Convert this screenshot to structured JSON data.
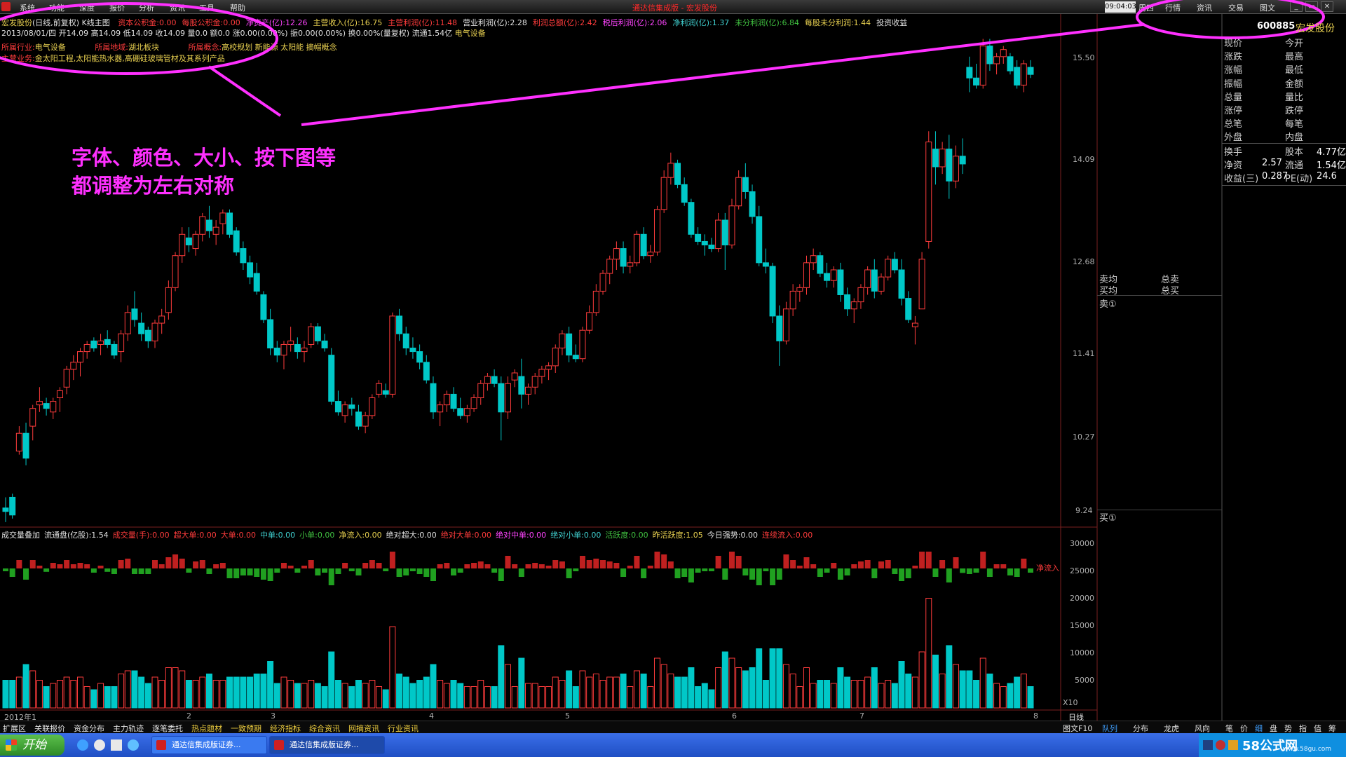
{
  "menu": {
    "items": [
      "系统",
      "功能",
      "深度",
      "报价",
      "分析",
      "资讯",
      "工具",
      "帮助"
    ],
    "app_title": "通达信集成版 - 宏发股份",
    "clock": "09:04:03",
    "weekday": "周四",
    "nav": [
      "行情",
      "资讯",
      "交易",
      "图文"
    ]
  },
  "header": {
    "stock_name": "宏发股份",
    "chart_mode": "(日线,前复权)",
    "chart_kind": "K线主图",
    "fund_items": [
      {
        "label": "资本公积金",
        "value": "0.00"
      },
      {
        "label": "每股公积金",
        "value": "0.00"
      },
      {
        "label": "净资产(亿)",
        "value": "12.26"
      },
      {
        "label": "主营收入(亿)",
        "value": "16.75"
      },
      {
        "label": "主营利润(亿)",
        "value": "11.48"
      },
      {
        "label": "营业利润(亿)",
        "value": "2.28"
      },
      {
        "label": "利润总额(亿)",
        "value": "2.42"
      },
      {
        "label": "税后利润(亿)",
        "value": "2.06"
      },
      {
        "label": "净利润(亿)",
        "value": "1.37"
      },
      {
        "label": "未分利润(亿)",
        "value": "6.84"
      },
      {
        "label": "每股未分利润",
        "value": "1.44"
      },
      {
        "label": "投资收益",
        "value": ""
      }
    ],
    "day_info": "2013/08/01/四 开14.09 高14.09 低14.09 收14.09 量0.0 额0.0 涨0.00(0.00%) 振0.00(0.00%) 换0.00%(量复权) 流通1.54亿",
    "sector": "电气设备",
    "industry_label": "所属行业:",
    "industry_value": "电气设备",
    "region_label": "所属地域:",
    "region_value": "湖北板块",
    "concept_label": "所属概念:",
    "concept_value": "高校规划 新能源 太阳能 摘帽概念",
    "business_label": "主营业务:",
    "business_value": "金太阳工程,太阳能热水器,高硼硅玻璃管材及其系列产品"
  },
  "annotation": {
    "line1": "字体、颜色、大小、按下图等",
    "line2": "都调整为左右对称"
  },
  "price_axis": [
    "15.50",
    "14.09",
    "12.68",
    "11.41",
    "10.27",
    "9.24"
  ],
  "vol_header": [
    {
      "text": "成交量叠加",
      "color": "white"
    },
    {
      "text": "流通盘(亿股):1.54",
      "color": "white"
    },
    {
      "text": "成交量(手):0.00",
      "color": "red"
    },
    {
      "text": "超大单:0.00",
      "color": "red"
    },
    {
      "text": "大单:0.00",
      "color": "red"
    },
    {
      "text": "中单:0.00",
      "color": "cyan"
    },
    {
      "text": "小单:0.00",
      "color": "green"
    },
    {
      "text": "净流入:0.00",
      "color": "yellow"
    },
    {
      "text": "绝对超大:0.00",
      "color": "white"
    },
    {
      "text": "绝对大单:0.00",
      "color": "red"
    },
    {
      "text": "绝对中单:0.00",
      "color": "magenta"
    },
    {
      "text": "绝对小单:0.00",
      "color": "cyan"
    },
    {
      "text": "活跃度:0.00",
      "color": "green"
    },
    {
      "text": "昨活跃度:1.05",
      "color": "yellow"
    },
    {
      "text": "今日强势:0.00",
      "color": "white"
    },
    {
      "text": "连续流入:0.00",
      "color": "red"
    }
  ],
  "vol_axis": [
    "30000",
    "25000",
    "20000",
    "15000",
    "10000",
    "5000"
  ],
  "net_inflow_label": "净流入",
  "x10": "X10",
  "date_axis": {
    "first": "2012年1",
    "ticks": [
      "2",
      "3",
      "4",
      "5",
      "6",
      "7",
      "8"
    ],
    "period": "日线"
  },
  "right_panel": {
    "code": "600885",
    "name": "宏发股份",
    "rows": [
      {
        "l": "现价",
        "r": "今开"
      },
      {
        "l": "涨跌",
        "r": "最高"
      },
      {
        "l": "涨幅",
        "r": "最低"
      },
      {
        "l": "振幅",
        "r": "金额"
      },
      {
        "l": "总量",
        "r": "量比"
      },
      {
        "l": "涨停",
        "r": "跌停"
      },
      {
        "l": "总笔",
        "r": "每笔"
      },
      {
        "l": "外盘",
        "r": "内盘"
      }
    ],
    "fin_rows": [
      {
        "l": "换手",
        "lv": "",
        "r": "股本",
        "rv": "4.77亿"
      },
      {
        "l": "净资",
        "lv": "2.57",
        "r": "流通",
        "rv": "1.54亿"
      },
      {
        "l": "收益(三)",
        "lv": "0.287",
        "r": "PE(动)",
        "rv": "24.6"
      }
    ]
  },
  "mid_panel": {
    "sell_avg": "卖均",
    "total_sell": "总卖",
    "buy_avg": "买均",
    "total_buy": "总买",
    "sell1": "卖①",
    "buy1": "买①"
  },
  "bottom_tabs": [
    "扩展区",
    "关联报价",
    "资金分布",
    "主力轨迹",
    "逐笔委托",
    "热点题材",
    "一致预期",
    "经济指标",
    "综合资讯",
    "网摘资讯",
    "行业资讯"
  ],
  "bottom_tabs_yellow": [
    5,
    6,
    7,
    8,
    9,
    10
  ],
  "bottom_right": {
    "f10": "图文F10",
    "tabs": [
      "队列",
      "分布",
      "龙虎",
      "风向"
    ],
    "small": [
      "笔",
      "价",
      "细",
      "盘",
      "势",
      "指",
      "值",
      "筹"
    ]
  },
  "taskbar": {
    "start": "开始",
    "tasks": [
      "通达信集成版证券...",
      "通达信集成版证券..."
    ],
    "watermark": "58公式网",
    "watermark_url": "www.58gu.com"
  },
  "chart_data": {
    "type": "candlestick",
    "y_axis_ticks": [
      15.5,
      14.09,
      12.68,
      11.41,
      10.27,
      9.24
    ],
    "ylim": [
      9.0,
      16.2
    ],
    "x_month_labels": [
      "2012年1",
      "2",
      "3",
      "4",
      "5",
      "6",
      "7",
      "8"
    ],
    "series": [
      {
        "name": "K线",
        "values": [
          [
            9.25,
            9.4,
            9.05,
            9.2
          ],
          [
            9.4,
            9.45,
            9.1,
            9.15
          ],
          [
            10.05,
            10.4,
            10.0,
            10.3
          ],
          [
            10.3,
            10.45,
            9.85,
            9.95
          ],
          [
            10.4,
            10.7,
            10.2,
            10.65
          ],
          [
            10.7,
            10.95,
            10.6,
            10.75
          ],
          [
            10.72,
            10.8,
            10.55,
            10.65
          ],
          [
            10.6,
            10.8,
            10.5,
            10.75
          ],
          [
            10.8,
            10.95,
            10.6,
            10.9
          ],
          [
            10.95,
            11.25,
            10.85,
            11.2
          ],
          [
            11.2,
            11.4,
            11.05,
            11.3
          ],
          [
            11.3,
            11.5,
            11.1,
            11.45
          ],
          [
            11.45,
            11.6,
            11.35,
            11.55
          ],
          [
            11.6,
            11.65,
            11.45,
            11.5
          ],
          [
            11.55,
            11.7,
            11.4,
            11.6
          ],
          [
            11.62,
            11.75,
            11.5,
            11.55
          ],
          [
            11.55,
            11.6,
            11.35,
            11.4
          ],
          [
            11.45,
            11.75,
            11.3,
            11.7
          ],
          [
            11.7,
            12.1,
            11.6,
            12.0
          ],
          [
            12.05,
            12.3,
            11.8,
            11.9
          ],
          [
            11.85,
            12.0,
            11.6,
            11.7
          ],
          [
            11.75,
            11.8,
            11.5,
            11.6
          ],
          [
            11.6,
            11.9,
            11.5,
            11.85
          ],
          [
            11.85,
            12.05,
            11.7,
            11.95
          ],
          [
            12.0,
            12.45,
            11.9,
            12.35
          ],
          [
            12.35,
            12.85,
            12.3,
            12.8
          ],
          [
            12.8,
            13.2,
            12.7,
            13.1
          ],
          [
            13.05,
            13.2,
            12.85,
            12.95
          ],
          [
            12.9,
            13.15,
            12.8,
            13.1
          ],
          [
            13.1,
            13.4,
            13.0,
            13.35
          ],
          [
            13.3,
            13.5,
            13.05,
            13.15
          ],
          [
            13.1,
            13.3,
            12.95,
            13.2
          ],
          [
            13.25,
            13.45,
            13.1,
            13.4
          ],
          [
            13.4,
            13.45,
            13.05,
            13.1
          ],
          [
            13.15,
            13.2,
            12.8,
            12.85
          ],
          [
            12.9,
            13.0,
            12.6,
            12.7
          ],
          [
            12.7,
            12.8,
            12.4,
            12.5
          ],
          [
            12.55,
            12.7,
            12.25,
            12.3
          ],
          [
            12.25,
            12.3,
            11.85,
            11.9
          ],
          [
            11.9,
            12.05,
            11.4,
            11.5
          ],
          [
            11.5,
            11.6,
            11.3,
            11.4
          ],
          [
            11.4,
            11.6,
            11.2,
            11.55
          ],
          [
            11.55,
            11.8,
            11.45,
            11.6
          ],
          [
            11.55,
            11.65,
            11.35,
            11.45
          ],
          [
            11.45,
            11.6,
            11.3,
            11.5
          ],
          [
            11.55,
            11.85,
            11.5,
            11.8
          ],
          [
            11.8,
            11.85,
            11.55,
            11.6
          ],
          [
            11.6,
            11.7,
            11.45,
            11.5
          ],
          [
            11.4,
            11.5,
            10.7,
            10.75
          ],
          [
            10.75,
            10.9,
            10.55,
            10.6
          ],
          [
            10.55,
            10.75,
            10.45,
            10.7
          ],
          [
            10.7,
            10.8,
            10.55,
            10.65
          ],
          [
            10.6,
            10.7,
            10.35,
            10.4
          ],
          [
            10.4,
            10.6,
            10.3,
            10.55
          ],
          [
            10.55,
            10.85,
            10.5,
            10.8
          ],
          [
            10.85,
            11.05,
            10.8,
            11.0
          ],
          [
            10.9,
            11.0,
            10.8,
            10.85
          ],
          [
            10.85,
            12.0,
            10.8,
            11.95
          ],
          [
            11.95,
            12.05,
            11.6,
            11.7
          ],
          [
            11.7,
            11.8,
            11.4,
            11.5
          ],
          [
            11.5,
            11.65,
            11.35,
            11.45
          ],
          [
            11.45,
            11.55,
            11.2,
            11.3
          ],
          [
            11.3,
            11.4,
            11.0,
            11.05
          ],
          [
            11.0,
            11.1,
            10.5,
            10.6
          ],
          [
            10.6,
            10.75,
            10.4,
            10.7
          ],
          [
            10.7,
            10.9,
            10.6,
            10.85
          ],
          [
            10.85,
            10.95,
            10.6,
            10.65
          ],
          [
            10.65,
            10.8,
            10.5,
            10.55
          ],
          [
            10.55,
            10.7,
            10.45,
            10.65
          ],
          [
            10.65,
            10.85,
            10.6,
            10.8
          ],
          [
            10.8,
            11.05,
            10.7,
            11.0
          ],
          [
            11.0,
            11.15,
            10.9,
            11.1
          ],
          [
            11.1,
            11.2,
            10.95,
            11.0
          ],
          [
            11.0,
            11.1,
            10.2,
            10.6
          ],
          [
            10.6,
            11.1,
            10.5,
            11.0
          ],
          [
            11.05,
            11.2,
            10.95,
            11.15
          ],
          [
            11.1,
            11.35,
            10.65,
            10.85
          ],
          [
            10.85,
            11.0,
            10.7,
            10.95
          ],
          [
            10.95,
            11.15,
            10.85,
            11.1
          ],
          [
            11.1,
            11.25,
            11.0,
            11.2
          ],
          [
            11.2,
            11.3,
            11.05,
            11.25
          ],
          [
            11.25,
            11.55,
            11.15,
            11.5
          ],
          [
            11.5,
            11.75,
            11.4,
            11.7
          ],
          [
            11.7,
            11.8,
            11.3,
            11.4
          ],
          [
            11.4,
            11.55,
            11.3,
            11.35
          ],
          [
            11.35,
            11.8,
            11.3,
            11.75
          ],
          [
            11.75,
            12.1,
            11.7,
            12.0
          ],
          [
            12.0,
            12.4,
            11.95,
            12.3
          ],
          [
            12.3,
            12.6,
            12.25,
            12.55
          ],
          [
            12.55,
            12.8,
            12.4,
            12.75
          ],
          [
            12.75,
            13.0,
            12.6,
            12.9
          ],
          [
            12.9,
            13.0,
            12.55,
            12.65
          ],
          [
            12.65,
            12.8,
            12.55,
            12.7
          ],
          [
            12.7,
            13.15,
            12.65,
            13.1
          ],
          [
            13.1,
            13.2,
            12.75,
            12.8
          ],
          [
            12.8,
            12.95,
            12.7,
            12.85
          ],
          [
            12.85,
            13.5,
            12.8,
            13.45
          ],
          [
            13.45,
            14.0,
            13.4,
            13.9
          ],
          [
            13.9,
            14.25,
            13.8,
            14.1
          ],
          [
            14.1,
            14.15,
            13.75,
            13.8
          ],
          [
            13.8,
            13.9,
            13.5,
            13.55
          ],
          [
            13.55,
            13.6,
            13.05,
            13.1
          ],
          [
            13.1,
            13.2,
            12.95,
            13.0
          ],
          [
            13.0,
            13.1,
            12.8,
            12.95
          ],
          [
            12.95,
            13.05,
            12.85,
            12.9
          ],
          [
            12.9,
            13.4,
            12.85,
            13.3
          ],
          [
            13.3,
            13.4,
            12.6,
            12.95
          ],
          [
            12.95,
            13.6,
            12.9,
            13.5
          ],
          [
            13.5,
            14.0,
            13.45,
            13.9
          ],
          [
            13.9,
            14.1,
            13.6,
            13.7
          ],
          [
            13.7,
            13.8,
            13.25,
            13.35
          ],
          [
            13.35,
            13.5,
            12.65,
            12.7
          ],
          [
            12.7,
            12.9,
            12.55,
            12.65
          ],
          [
            12.65,
            12.7,
            11.85,
            11.95
          ],
          [
            11.95,
            12.1,
            11.25,
            11.6
          ],
          [
            11.6,
            12.15,
            11.55,
            12.05
          ],
          [
            12.05,
            12.4,
            11.95,
            12.3
          ],
          [
            12.3,
            12.4,
            12.15,
            12.35
          ],
          [
            12.35,
            12.8,
            12.25,
            12.7
          ],
          [
            12.7,
            12.9,
            12.6,
            12.8
          ],
          [
            12.8,
            12.85,
            12.5,
            12.55
          ],
          [
            12.55,
            12.7,
            12.35,
            12.45
          ],
          [
            12.45,
            12.65,
            12.35,
            12.6
          ],
          [
            12.6,
            12.7,
            12.15,
            12.25
          ],
          [
            12.25,
            12.35,
            11.95,
            12.05
          ],
          [
            12.05,
            12.2,
            11.85,
            12.15
          ],
          [
            12.15,
            12.4,
            12.05,
            12.35
          ],
          [
            12.35,
            12.65,
            12.25,
            12.6
          ],
          [
            12.6,
            12.75,
            12.2,
            12.3
          ],
          [
            12.3,
            12.55,
            12.25,
            12.5
          ],
          [
            12.5,
            12.8,
            12.45,
            12.75
          ],
          [
            12.75,
            12.85,
            12.55,
            12.6
          ],
          [
            12.6,
            12.75,
            12.1,
            12.2
          ],
          [
            12.2,
            12.3,
            11.85,
            11.9
          ],
          [
            11.8,
            11.95,
            11.55,
            11.85
          ],
          [
            12.05,
            12.85,
            12.05,
            12.75
          ],
          [
            13.0,
            14.55,
            12.9,
            14.4
          ],
          [
            14.3,
            14.55,
            13.8,
            14.05
          ],
          [
            14.05,
            14.4,
            13.95,
            14.3
          ],
          [
            14.3,
            14.5,
            13.6,
            13.85
          ],
          [
            13.85,
            14.35,
            13.75,
            14.2
          ],
          [
            14.2,
            14.45,
            13.95,
            14.09
          ],
          [
            15.45,
            15.6,
            15.1,
            15.3
          ],
          [
            15.3,
            15.5,
            15.15,
            15.2
          ],
          [
            15.2,
            15.85,
            15.15,
            15.75
          ],
          [
            15.75,
            15.85,
            15.4,
            15.5
          ],
          [
            15.5,
            15.65,
            15.35,
            15.6
          ],
          [
            15.6,
            15.75,
            15.5,
            15.7
          ],
          [
            15.6,
            15.65,
            15.35,
            15.4
          ],
          [
            15.45,
            15.55,
            15.15,
            15.2
          ],
          [
            15.2,
            15.55,
            15.1,
            15.5
          ],
          [
            15.45,
            15.55,
            15.3,
            15.35
          ]
        ]
      }
    ]
  }
}
